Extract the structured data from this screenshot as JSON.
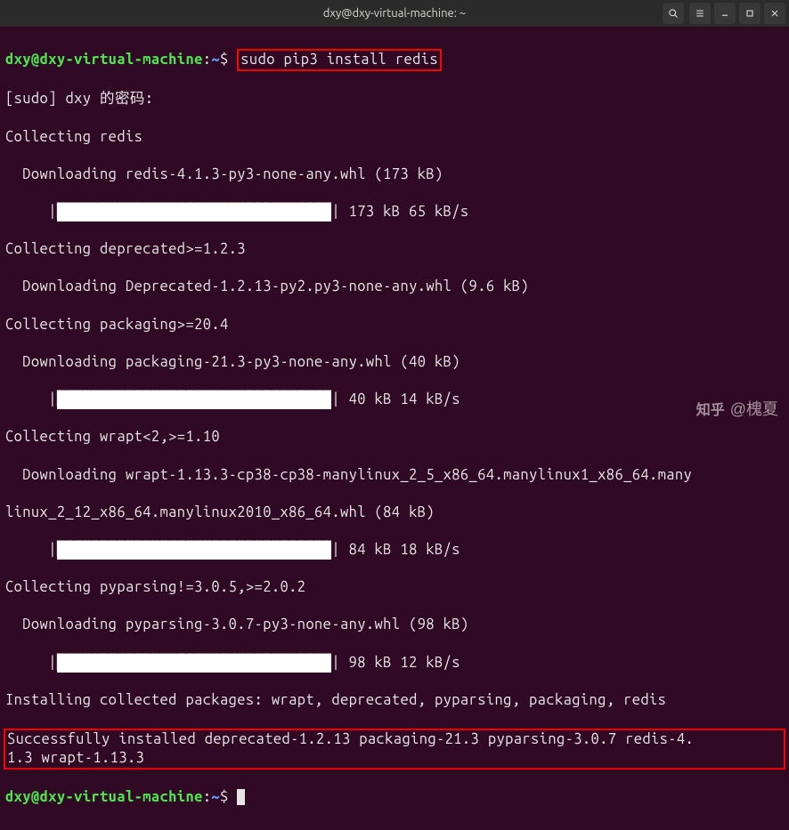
{
  "window": {
    "title": "dxy@dxy-virtual-machine: ~"
  },
  "prompt": {
    "user": "dxy",
    "at": "@",
    "host": "dxy-virtual-machine",
    "colon": ":",
    "path": "~",
    "dollar": "$"
  },
  "cmd1": "sudo pip3 install redis",
  "lines": {
    "sudo_pwd": "[sudo] dxy 的密码:",
    "collecting_redis": "Collecting redis",
    "dl_redis": "  Downloading redis-4.1.3-py3-none-any.whl (173 kB)",
    "bar_redis_pre": "     |",
    "bar_redis_fill": "████████████████████████████████",
    "bar_redis_post": "| 173 kB 65 kB/s",
    "collecting_deprecated": "Collecting deprecated>=1.2.3",
    "dl_deprecated": "  Downloading Deprecated-1.2.13-py2.py3-none-any.whl (9.6 kB)",
    "collecting_packaging": "Collecting packaging>=20.4",
    "dl_packaging": "  Downloading packaging-21.3-py3-none-any.whl (40 kB)",
    "bar_pkg_pre": "     |",
    "bar_pkg_fill": "████████████████████████████████",
    "bar_pkg_post": "| 40 kB 14 kB/s",
    "collecting_wrapt": "Collecting wrapt<2,>=1.10",
    "dl_wrapt1": "  Downloading wrapt-1.13.3-cp38-cp38-manylinux_2_5_x86_64.manylinux1_x86_64.many",
    "dl_wrapt2": "linux_2_12_x86_64.manylinux2010_x86_64.whl (84 kB)",
    "bar_wrapt_pre": "     |",
    "bar_wrapt_fill": "████████████████████████████████",
    "bar_wrapt_post": "| 84 kB 18 kB/s",
    "collecting_pyparsing": "Collecting pyparsing!=3.0.5,>=2.0.2",
    "dl_pyparsing": "  Downloading pyparsing-3.0.7-py3-none-any.whl (98 kB)",
    "bar_pyp_pre": "     |",
    "bar_pyp_fill": "████████████████████████████████",
    "bar_pyp_post": "| 98 kB 12 kB/s",
    "installing": "Installing collected packages: wrapt, deprecated, pyparsing, packaging, redis",
    "success1": "Successfully installed deprecated-1.2.13 packaging-21.3 pyparsing-3.0.7 redis-4.",
    "success2": "1.3 wrapt-1.13.3"
  },
  "watermark": {
    "site": "知乎",
    "author": "@槐夏"
  }
}
